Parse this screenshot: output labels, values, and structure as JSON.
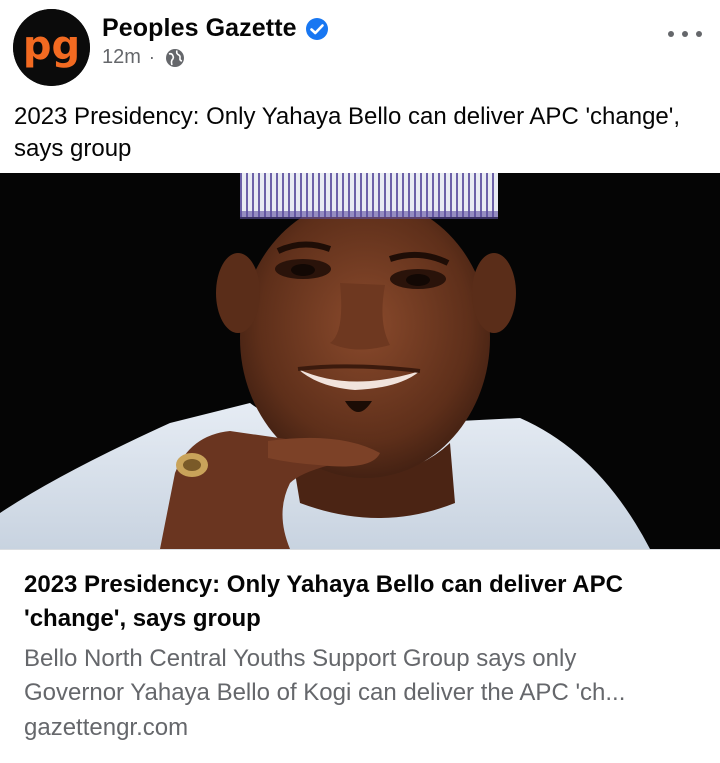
{
  "header": {
    "page_name": "Peoples Gazette",
    "avatar_text": "pg",
    "time": "12m",
    "separator": "·",
    "verified_icon": "verified-badge-icon",
    "privacy_icon": "globe-icon",
    "more_icon": "more-options-icon"
  },
  "post": {
    "text": "2023 Presidency: Only Yahaya Bello can deliver APC 'change', says group"
  },
  "link_card": {
    "title": "2023 Presidency: Only Yahaya Bello can deliver APC 'change', says group",
    "description_line1": "Bello North Central Youths Support Group says only",
    "description_line2": "Governor Yahaya Bello of Kogi can deliver the APC 'ch...",
    "domain": "gazettengr.com"
  },
  "colors": {
    "brand_orange": "#f26a21",
    "verified_blue": "#1877f2",
    "secondary_text": "#65676b",
    "image_background": "#050505"
  }
}
